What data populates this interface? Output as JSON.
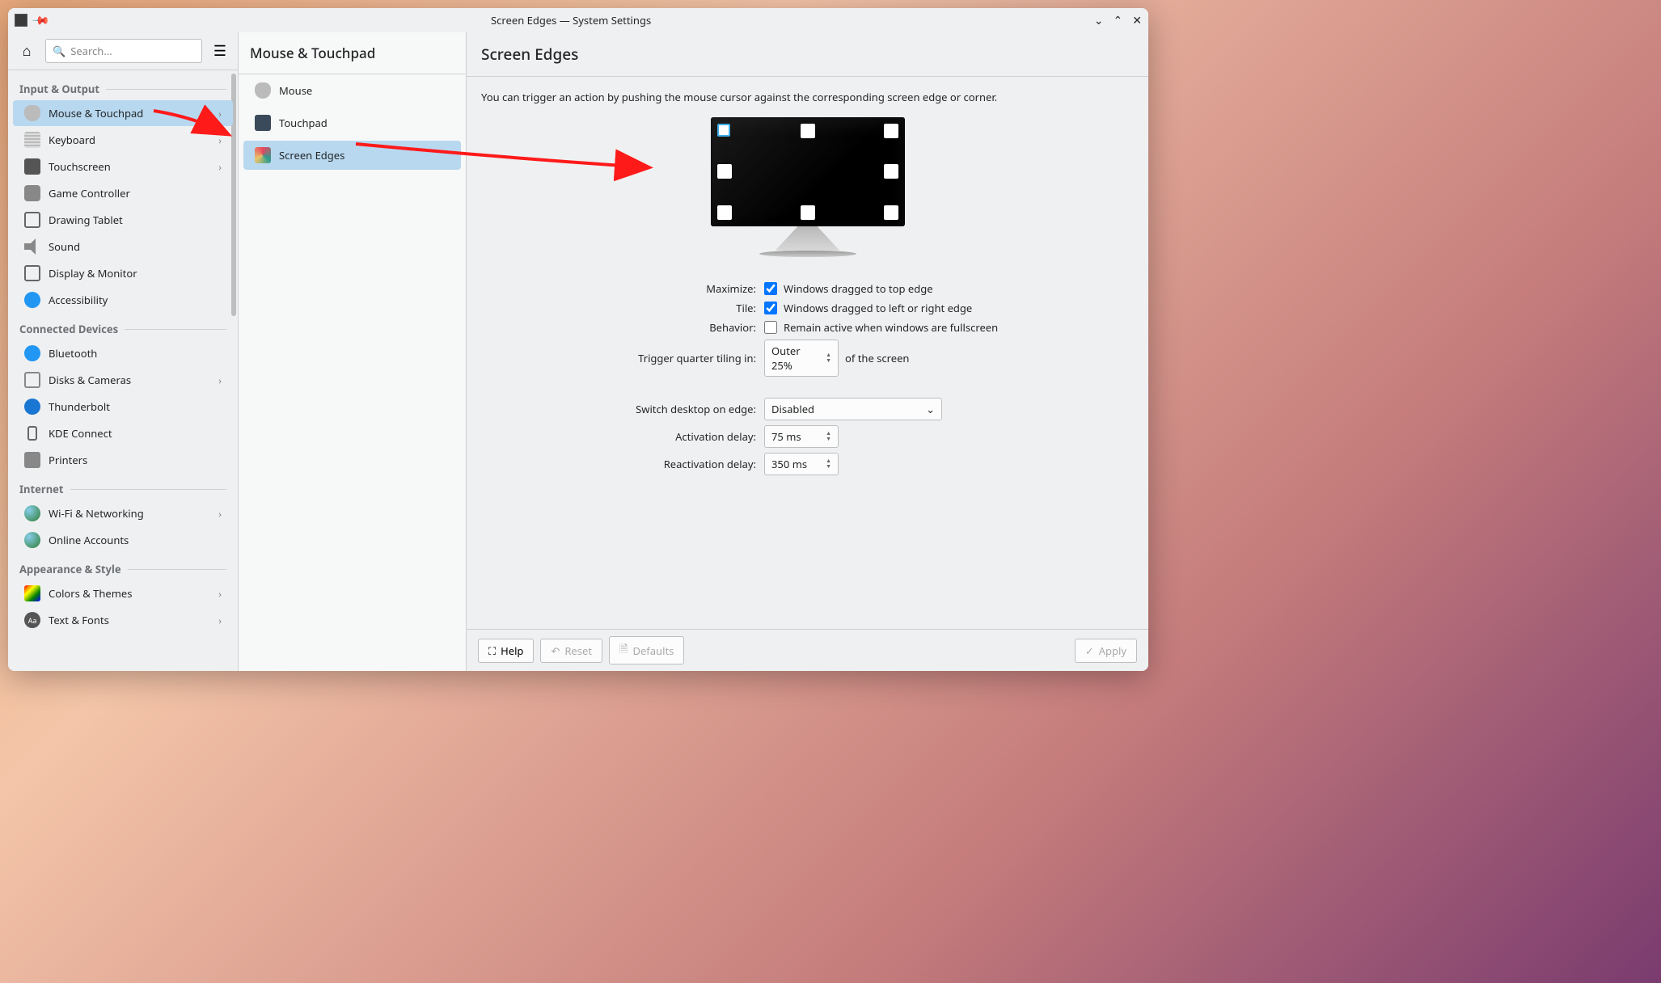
{
  "titlebar": {
    "title": "Screen Edges — System Settings"
  },
  "sidebar": {
    "search_placeholder": "Search...",
    "sections": {
      "io": "Input & Output",
      "connected": "Connected Devices",
      "internet": "Internet",
      "appearance": "Appearance & Style"
    },
    "items": {
      "mouse_touchpad": "Mouse & Touchpad",
      "keyboard": "Keyboard",
      "touchscreen": "Touchscreen",
      "game_controller": "Game Controller",
      "drawing_tablet": "Drawing Tablet",
      "sound": "Sound",
      "display_monitor": "Display & Monitor",
      "accessibility": "Accessibility",
      "bluetooth": "Bluetooth",
      "disks_cameras": "Disks & Cameras",
      "thunderbolt": "Thunderbolt",
      "kde_connect": "KDE Connect",
      "printers": "Printers",
      "wifi_networking": "Wi-Fi & Networking",
      "online_accounts": "Online Accounts",
      "colors_themes": "Colors & Themes",
      "text_fonts": "Text & Fonts"
    }
  },
  "middle": {
    "header": "Mouse & Touchpad",
    "items": {
      "mouse": "Mouse",
      "touchpad": "Touchpad",
      "screen_edges": "Screen Edges"
    }
  },
  "main": {
    "header": "Screen Edges",
    "description": "You can trigger an action by pushing the mouse cursor against the corresponding screen edge or corner.",
    "labels": {
      "maximize": "Maximize:",
      "tile": "Tile:",
      "behavior": "Behavior:",
      "quarter": "Trigger quarter tiling in:",
      "switch": "Switch desktop on edge:",
      "activation": "Activation delay:",
      "reactivation": "Reactivation delay:"
    },
    "values": {
      "maximize_cb": "Windows dragged to top edge",
      "tile_cb": "Windows dragged to left or right edge",
      "behavior_cb": "Remain active when windows are fullscreen",
      "quarter_val": "Outer 25%",
      "quarter_suffix": "of the screen",
      "switch_val": "Disabled",
      "activation_val": "75 ms",
      "reactivation_val": "350 ms"
    }
  },
  "footer": {
    "help": "Help",
    "reset": "Reset",
    "defaults": "Defaults",
    "apply": "Apply"
  }
}
